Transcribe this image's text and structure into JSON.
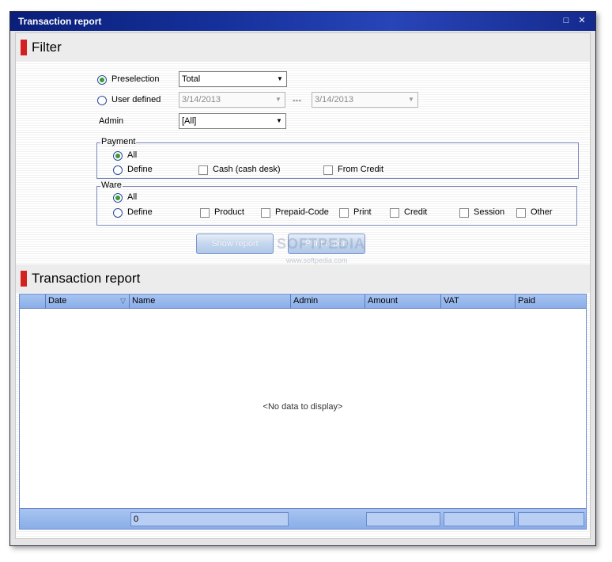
{
  "window": {
    "title": "Transaction report"
  },
  "filter": {
    "heading": "Filter",
    "preselection_label": "Preselection",
    "preselection_value": "Total",
    "user_defined_label": "User defined",
    "date_from": "3/14/2013",
    "date_separator": "---",
    "date_to": "3/14/2013",
    "admin_label": "Admin",
    "admin_value": "[All]",
    "payment": {
      "legend": "Payment",
      "all_label": "All",
      "define_label": "Define",
      "options": [
        "Cash (cash desk)",
        "From Credit"
      ]
    },
    "ware": {
      "legend": "Ware",
      "all_label": "All",
      "define_label": "Define",
      "options": [
        "Product",
        "Prepaid-Code",
        "Print",
        "Credit",
        "Session",
        "Other"
      ]
    },
    "show_report_label": "Show report",
    "print_report_label": "Print report"
  },
  "report": {
    "heading": "Transaction report",
    "columns": [
      "Date",
      "Name",
      "Admin",
      "Amount",
      "VAT",
      "Paid"
    ],
    "empty_message": "<No data to display>",
    "footer_count": "0"
  },
  "watermark": {
    "brand": "SOFTPEDIA",
    "url": "www.softpedia.com"
  },
  "colors": {
    "titlebar": "#14309a",
    "accent_red": "#d42020",
    "grid_header": "#8aaee8",
    "radio_dot": "#3a9a3a"
  }
}
